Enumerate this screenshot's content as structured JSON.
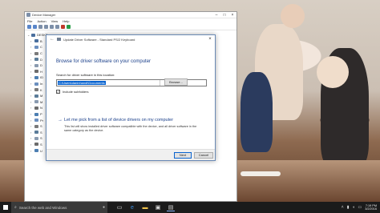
{
  "device_manager": {
    "title": "Device Manager",
    "menu": [
      "File",
      "Action",
      "View",
      "Help"
    ],
    "root_node": "DESKT",
    "tree_items": [
      "B",
      "C",
      "C",
      "D",
      "D",
      "H",
      "ID",
      "In",
      "K",
      "M",
      "M",
      "N",
      "P",
      "Pr",
      "S",
      "S",
      "S",
      "S",
      "U"
    ]
  },
  "dialog": {
    "title": "Update Driver Software - Standard PS/2 Keyboard",
    "heading": "Browse for driver software on your computer",
    "search_label": "Search for driver software in this location:",
    "path_value": "C:\\Users\\daninhandi\\Documents",
    "browse_label": "Browse...",
    "include_subfolders_label": "Include subfolders",
    "include_subfolders_checked": true,
    "pick_title": "Let me pick from a list of device drivers on my computer",
    "pick_description": "This list will show installed driver software compatible with the device, and all driver software in the same category as the device.",
    "next_label": "Next",
    "cancel_label": "Cancel"
  },
  "taskbar": {
    "search_placeholder": "Search the web and Windows",
    "clock_time": "7:19 PM",
    "clock_date": "3/2/2016"
  },
  "colors": {
    "accent_blue": "#1a3f8a",
    "selection_blue": "#0a64d0",
    "taskbar_bg": "#1b1b1b"
  },
  "icons": {
    "start": "windows-logo-icon",
    "search": "search-icon",
    "mic": "microphone-icon"
  }
}
